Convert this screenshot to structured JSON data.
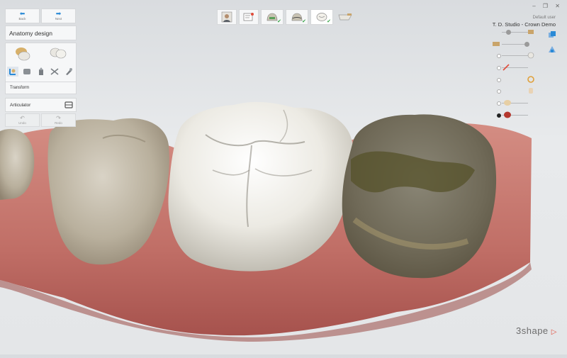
{
  "nav": {
    "back_label": "Back",
    "next_label": "Next"
  },
  "panel": {
    "title": "Anatomy design",
    "transform_label": "Transform",
    "articulator_label": "Articulator"
  },
  "history": {
    "undo_label": "Undo",
    "redo_label": "Redo"
  },
  "user": {
    "name": "Default user",
    "case_title": "T. D. Studio - Crown Demo"
  },
  "window": {
    "controls": "– ❐ ✕"
  },
  "brand": {
    "logo_text": "3shape"
  },
  "colors": {
    "accent": "#2a8ad6",
    "check": "#3aa54a",
    "brand_red": "#e04b3a",
    "gum": "#c97a72",
    "crown": "#eeece6"
  },
  "workflow_steps": [
    "patient-icon",
    "order-icon",
    "preparation-icon",
    "margin-icon",
    "crown-design-icon",
    "finish-icon"
  ],
  "visibility": {
    "selected_index": 7
  }
}
